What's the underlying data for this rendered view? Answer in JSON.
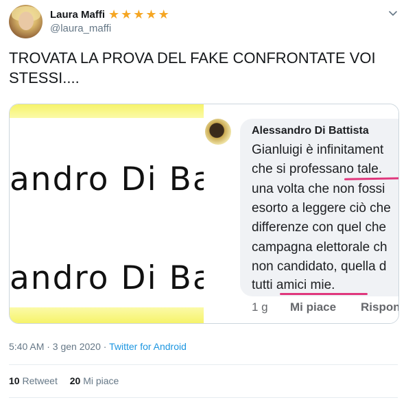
{
  "user": {
    "display_name": "Laura Maffi",
    "stars": "★★★★★",
    "handle": "@laura_maffi"
  },
  "tweet": {
    "text_line1": "TROVATA LA PROVA DEL FAKE CONFRONTATE VOI",
    "text_line2": "STESSI...."
  },
  "media": {
    "zoom_text_top": "andro Di Ba",
    "zoom_text_bottom": "andro Di Ba",
    "comment_author": "Alessandro Di Battista",
    "comment_lines": [
      "Gianluigi è infinitament",
      "che si professano tale.",
      "una volta che non fossi",
      "esorto a leggere ciò che",
      "differenze con quel che",
      "campagna elettorale ch",
      "non candidato, quella d",
      "tutti amici mie."
    ],
    "action_time": "1 g",
    "action_like": "Mi piace",
    "action_reply": "Rispon"
  },
  "meta": {
    "timestamp": "5:40 AM · 3 gen 2020 · ",
    "source": "Twitter for Android"
  },
  "stats": {
    "retweets_count": "10",
    "retweets_label": "Retweet",
    "likes_count": "20",
    "likes_label": "Mi piace"
  },
  "icons": {
    "stars": "star-icon",
    "caret": "chevron-down-icon"
  },
  "colors": {
    "link": "#1b95e0",
    "star": "#f5a623",
    "underline": "#e0367c",
    "highlight": "#f6f36a"
  }
}
